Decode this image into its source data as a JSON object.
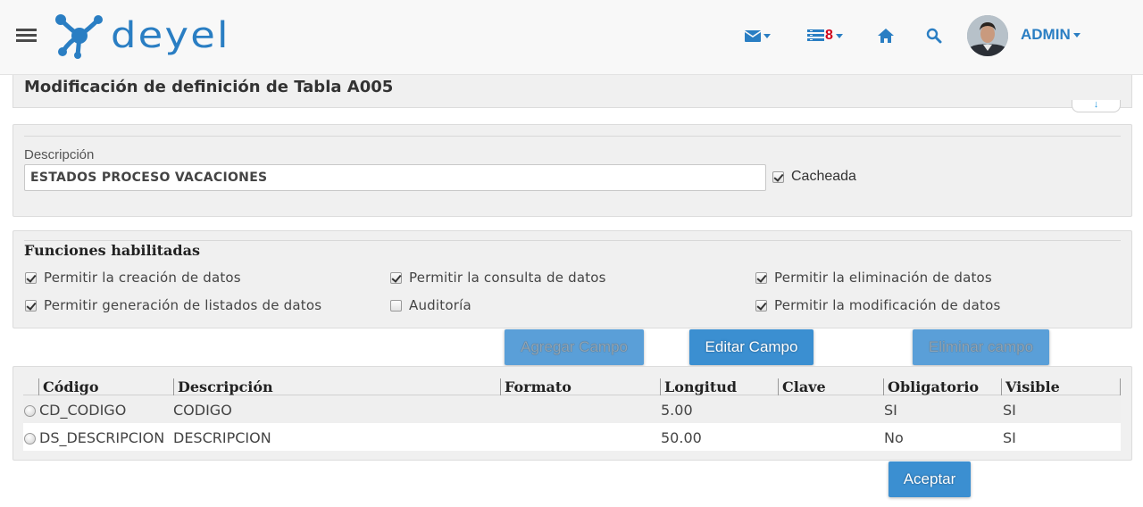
{
  "header": {
    "logo_text": "deyel",
    "notification_count": "8",
    "user_name": "ADMIN",
    "accent_color": "#2a7ec3",
    "icons": [
      "menu-icon",
      "mail-icon",
      "tasks-icon",
      "home-icon",
      "search-icon"
    ]
  },
  "page": {
    "title": "Modificación de definición de Tabla A005"
  },
  "description_panel": {
    "label": "Descripción",
    "value": "ESTADOS PROCESO VACACIONES",
    "cached_label": "Cacheada",
    "cached_checked": true
  },
  "functions_panel": {
    "title": "Funciones habilitadas",
    "options": [
      {
        "label": "Permitir la creación de datos",
        "checked": true
      },
      {
        "label": "Permitir la consulta de datos",
        "checked": true
      },
      {
        "label": "Permitir la eliminación de datos",
        "checked": true
      },
      {
        "label": "Permitir generación de listados de datos",
        "checked": true
      },
      {
        "label": "Auditoría",
        "checked": false
      },
      {
        "label": "Permitir la modificación de datos",
        "checked": true
      }
    ]
  },
  "actions": {
    "add_field": "Agregar Campo",
    "edit_field": "Editar Campo",
    "delete_field": "Eliminar campo",
    "accept": "Aceptar"
  },
  "fields_table": {
    "columns": [
      "Código",
      "Descripción",
      "Formato",
      "Longitud",
      "Clave",
      "Obligatorio",
      "Visible"
    ],
    "rows": [
      [
        "CD_CODIGO",
        "CODIGO",
        "",
        "5.00",
        "",
        "SI",
        "SI"
      ],
      [
        "DS_DESCRIPCION",
        "DESCRIPCION",
        "",
        "50.00",
        "",
        "No",
        "SI"
      ]
    ]
  }
}
